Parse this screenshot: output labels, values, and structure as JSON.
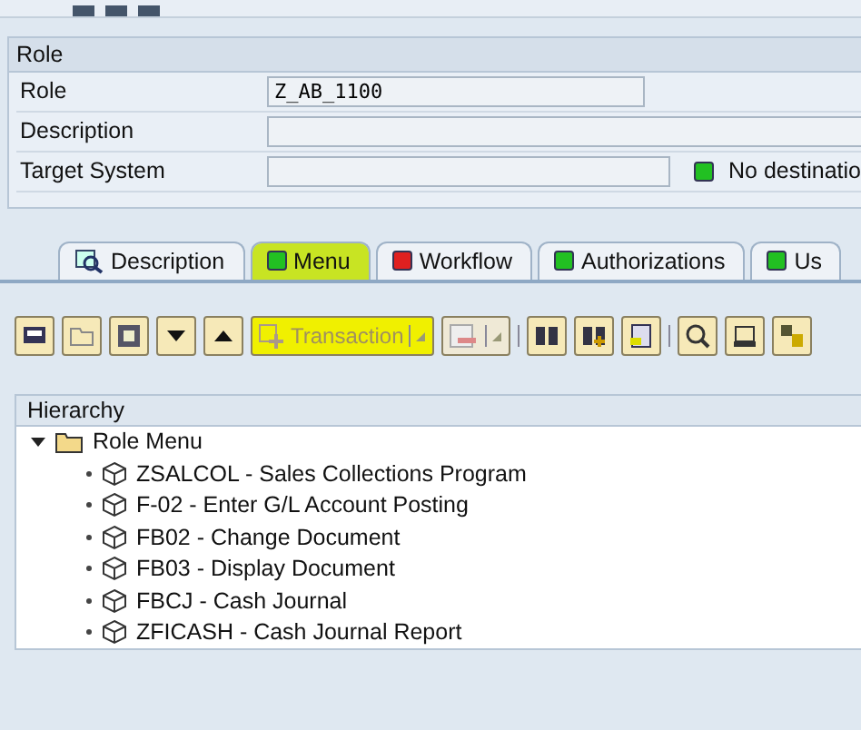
{
  "role_section": {
    "title": "Role",
    "fields": [
      {
        "label": "Role",
        "value": "Z_AB_1100"
      },
      {
        "label": "Description"
      },
      {
        "label": "Target System",
        "status": {
          "color": "#22c022",
          "text": "No destinatio"
        }
      }
    ]
  },
  "tabs": [
    {
      "label": "Description",
      "kind": "icon",
      "selected": false,
      "highlighted": false
    },
    {
      "label": "Menu",
      "kind": "status",
      "color": "#22c022",
      "selected": true,
      "highlighted": true
    },
    {
      "label": "Workflow",
      "kind": "status",
      "color": "#e02020",
      "selected": false,
      "highlighted": false
    },
    {
      "label": "Authorizations",
      "kind": "status",
      "color": "#22c022",
      "selected": false,
      "highlighted": false
    },
    {
      "label": "Us",
      "kind": "status",
      "color": "#22c022",
      "selected": false,
      "highlighted": false
    }
  ],
  "toolbar": [
    {
      "kind": "icon",
      "disabled": false
    },
    {
      "kind": "icon",
      "disabled": false
    },
    {
      "kind": "icon",
      "disabled": false
    },
    {
      "kind": "icon",
      "disabled": false
    },
    {
      "kind": "icon",
      "disabled": false
    },
    {
      "kind": "split",
      "label": "Transaction",
      "disabled": true,
      "highlighted": true
    },
    {
      "kind": "split",
      "disabled": true,
      "highlighted": false
    },
    {
      "kind": "icon",
      "disabled": false
    },
    {
      "kind": "icon",
      "disabled": false
    },
    {
      "kind": "icon",
      "disabled": false
    },
    {
      "kind": "icon",
      "disabled": false
    },
    {
      "kind": "icon",
      "disabled": false
    },
    {
      "kind": "icon",
      "disabled": false
    }
  ],
  "hierarchy": {
    "title": "Hierarchy",
    "tree": [
      {
        "label": "Role Menu",
        "expanded": true,
        "children": [
          {
            "label": "ZSALCOL - Sales Collections Program"
          },
          {
            "label": "F-02 - Enter G/L Account Posting"
          },
          {
            "label": "FB02 - Change Document"
          },
          {
            "label": "FB03 - Display Document"
          },
          {
            "label": "FBCJ - Cash Journal"
          },
          {
            "label": "ZFICASH - Cash Journal Report"
          }
        ]
      }
    ]
  }
}
